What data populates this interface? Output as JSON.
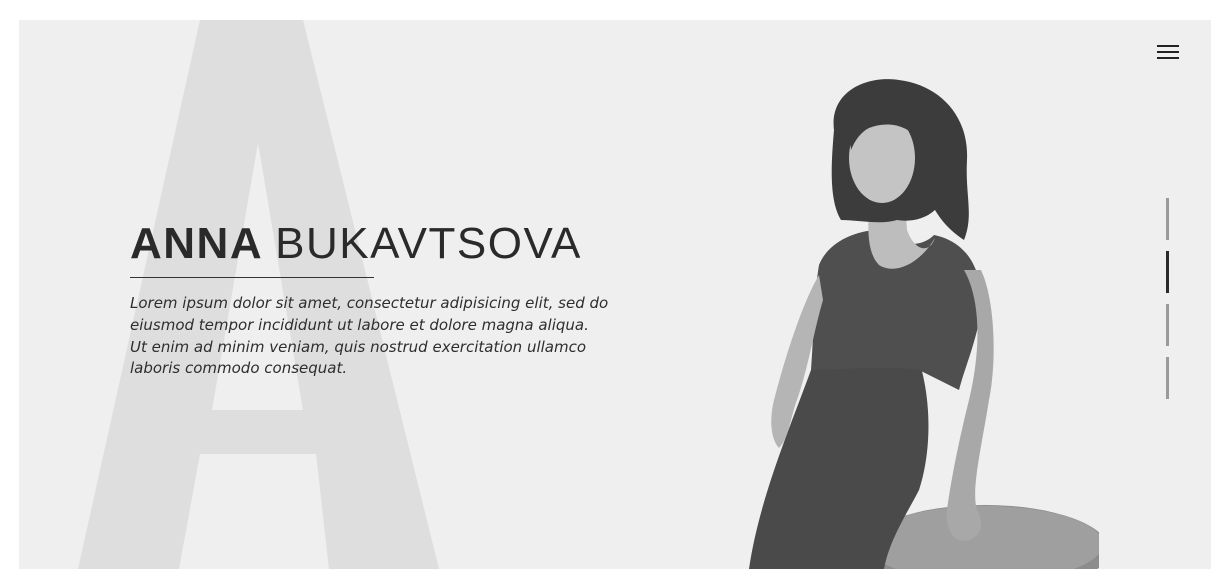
{
  "hero": {
    "bg_letter": "A",
    "first_name": "ANNA",
    "last_name": "BUKAVTSOVA",
    "intro": "Lorem ipsum dolor sit amet, consectetur adipisicing elit, sed do eiusmod tempor incididunt ut labore et dolore magna aliqua. Ut enim ad minim veniam, quis nostrud exercitation ullamco laboris commodo consequat."
  },
  "menu": {
    "icon": "hamburger-menu-icon"
  },
  "slide_nav": {
    "count": 4,
    "active_index": 1
  },
  "colors": {
    "background": "#efefef",
    "text": "#2a2a2a",
    "bg_letter": "#dedede",
    "indicator_active": "#2a2a2a",
    "indicator_inactive": "#9a9a9a"
  }
}
